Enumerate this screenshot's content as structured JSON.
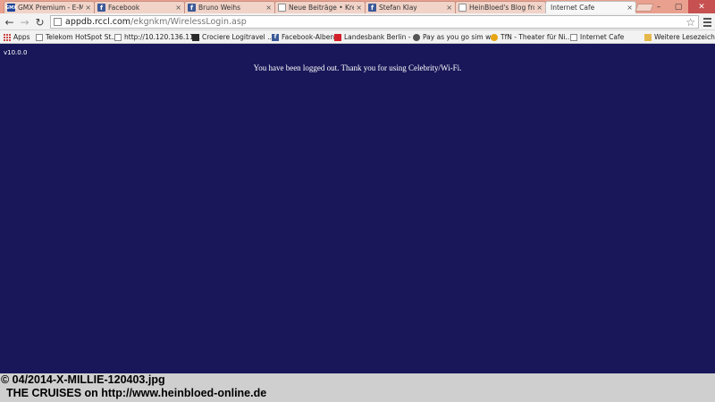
{
  "tabs": [
    {
      "title": "GMX Premium - E-Ma",
      "icon": "gmx-icon",
      "fav": "GMX",
      "favclass": "fav-gmx"
    },
    {
      "title": "Facebook",
      "icon": "facebook-icon",
      "fav": "f",
      "favclass": "fav-fb"
    },
    {
      "title": "Bruno Weihs",
      "icon": "facebook-icon",
      "fav": "f",
      "favclass": "fav-fb"
    },
    {
      "title": "Neue Beiträge • Kreuzf",
      "icon": "page-icon",
      "fav": "",
      "favclass": "fav-page"
    },
    {
      "title": "Stefan Klay",
      "icon": "facebook-icon",
      "fav": "f",
      "favclass": "fav-fb"
    },
    {
      "title": "HeinBloed's Blog from",
      "icon": "page-icon",
      "fav": "",
      "favclass": "fav-page"
    },
    {
      "title": "Internet Cafe",
      "icon": "none",
      "fav": "",
      "favclass": "fav-none"
    }
  ],
  "window_controls": {
    "minimize": "–",
    "maximize": "▢",
    "close": "✕"
  },
  "nav": {
    "back": "←",
    "forward": "→",
    "reload": "↻"
  },
  "address": {
    "host": "appdb.rccl.com",
    "path": "/ekgnkm/WirelessLogin.asp"
  },
  "bookmarks": [
    {
      "label": "Apps",
      "icon": "apps-icon",
      "cls": "ic-apps"
    },
    {
      "label": "Telekom HotSpot St...",
      "icon": "page-icon",
      "cls": "ic-page"
    },
    {
      "label": "http://10.120.136.11...",
      "icon": "page-icon",
      "cls": "ic-page"
    },
    {
      "label": "Crociere Logitravel ...",
      "icon": "logitravel-icon",
      "cls": "ic-logi"
    },
    {
      "label": "Facebook-Alben",
      "icon": "facebook-icon",
      "cls": "ic-fb"
    },
    {
      "label": "Landesbank Berlin - ...",
      "icon": "landesbank-icon",
      "cls": "ic-lb"
    },
    {
      "label": "Pay as you go sim w...",
      "icon": "globe-icon",
      "cls": "ic-pay"
    },
    {
      "label": "TfN - Theater für Ni...",
      "icon": "tfn-icon",
      "cls": "ic-tfn"
    },
    {
      "label": "Internet Cafe",
      "icon": "page-icon",
      "cls": "ic-page"
    },
    {
      "label": "Weitere Lesezeichen",
      "icon": "folder-icon",
      "cls": "ic-folder"
    }
  ],
  "page": {
    "version": "v10.0.0",
    "message": "You have been logged out. Thank you for using Celebrity/Wi-Fi."
  },
  "caption": {
    "line1": "© 04/2014-X-MILLIE-120403.jpg",
    "line2": "THE CRUISES on http://www.heinbloed-online.de"
  }
}
